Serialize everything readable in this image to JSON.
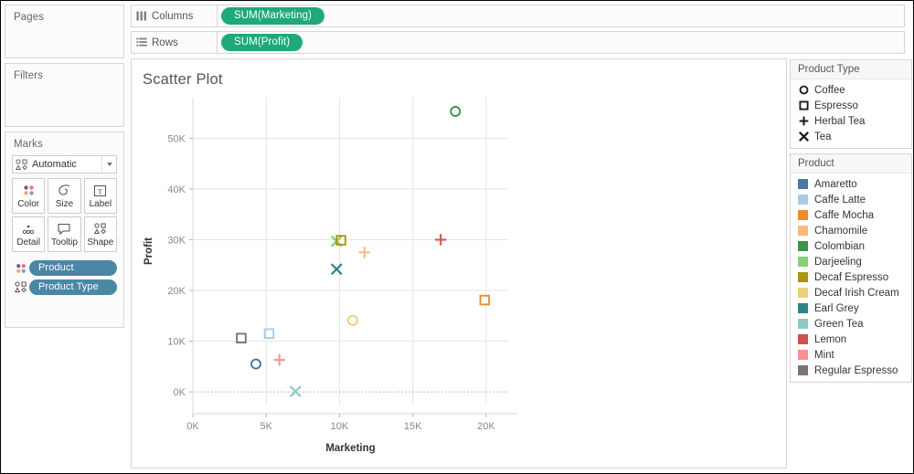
{
  "left_panel": {
    "pages": {
      "title": "Pages"
    },
    "filters": {
      "title": "Filters"
    },
    "marks": {
      "title": "Marks",
      "type_selector": {
        "label": "Automatic",
        "icon": "shapes-icon",
        "dropdown_icon": "chevron-down-icon"
      },
      "buttons": [
        {
          "label": "Color",
          "icon": "color-dots-icon"
        },
        {
          "label": "Size",
          "icon": "size-teardrop-icon"
        },
        {
          "label": "Label",
          "icon": "label-text-icon"
        },
        {
          "label": "Detail",
          "icon": "detail-dots-icon"
        },
        {
          "label": "Tooltip",
          "icon": "tooltip-bubble-icon"
        },
        {
          "label": "Shape",
          "icon": "shapes-icon"
        }
      ],
      "pills": [
        {
          "label": "Product",
          "icon": "color-dots-icon"
        },
        {
          "label": "Product Type",
          "icon": "shapes-icon"
        }
      ]
    }
  },
  "shelves": {
    "columns": {
      "label": "Columns",
      "icon": "columns-icon",
      "pill": "SUM(Marketing)"
    },
    "rows": {
      "label": "Rows",
      "icon": "rows-icon",
      "pill": "SUM(Profit)"
    }
  },
  "legends": {
    "product_type": {
      "title": "Product Type",
      "items": [
        {
          "label": "Coffee",
          "shape": "circle"
        },
        {
          "label": "Espresso",
          "shape": "square"
        },
        {
          "label": "Herbal Tea",
          "shape": "plus"
        },
        {
          "label": "Tea",
          "shape": "cross"
        }
      ]
    },
    "product": {
      "title": "Product",
      "items": [
        {
          "label": "Amaretto",
          "color": "#4878a8"
        },
        {
          "label": "Caffe Latte",
          "color": "#a8cce4"
        },
        {
          "label": "Caffe Mocha",
          "color": "#ee8c2a"
        },
        {
          "label": "Chamomile",
          "color": "#fbb77c"
        },
        {
          "label": "Colombian",
          "color": "#3f9448"
        },
        {
          "label": "Darjeeling",
          "color": "#84d176"
        },
        {
          "label": "Decaf Espresso",
          "color": "#a8960f"
        },
        {
          "label": "Decaf Irish Cream",
          "color": "#ecd074"
        },
        {
          "label": "Earl Grey",
          "color": "#2c8489"
        },
        {
          "label": "Green Tea",
          "color": "#8fcbc5"
        },
        {
          "label": "Lemon",
          "color": "#d0504c"
        },
        {
          "label": "Mint",
          "color": "#f79190"
        },
        {
          "label": "Regular Espresso",
          "color": "#7d7370"
        }
      ]
    }
  },
  "chart_data": {
    "type": "scatter",
    "title": "Scatter Plot",
    "xlabel": "Marketing",
    "ylabel": "Profit",
    "xlim": [
      0,
      21500
    ],
    "ylim": [
      -2500,
      58000
    ],
    "xticks": [
      0,
      5000,
      10000,
      15000,
      20000
    ],
    "xticklabels": [
      "0K",
      "5K",
      "10K",
      "15K",
      "20K"
    ],
    "yticks": [
      0,
      10000,
      20000,
      30000,
      40000,
      50000
    ],
    "yticklabels": [
      "0K",
      "10K",
      "20K",
      "30K",
      "40K",
      "50K"
    ],
    "grid": true,
    "points": [
      {
        "label": "Colombian",
        "product_type": "Coffee",
        "shape": "circle",
        "color": "#3f9448",
        "x": 17900,
        "y": 55300
      },
      {
        "label": "Darjeeling",
        "product_type": "Tea",
        "shape": "cross",
        "color": "#84d176",
        "x": 9800,
        "y": 29700
      },
      {
        "label": "Decaf Espresso",
        "product_type": "Espresso",
        "shape": "square",
        "color": "#a8960f",
        "x": 10100,
        "y": 29900
      },
      {
        "label": "Chamomile",
        "product_type": "Herbal Tea",
        "shape": "plus",
        "color": "#fbb77c",
        "x": 11700,
        "y": 27500
      },
      {
        "label": "Lemon",
        "product_type": "Herbal Tea",
        "shape": "plus",
        "color": "#d0504c",
        "x": 16900,
        "y": 30000
      },
      {
        "label": "Earl Grey",
        "product_type": "Tea",
        "shape": "cross",
        "color": "#2c8489",
        "x": 9800,
        "y": 24200
      },
      {
        "label": "Caffe Mocha",
        "product_type": "Espresso",
        "shape": "square",
        "color": "#ee8c2a",
        "x": 19900,
        "y": 18100
      },
      {
        "label": "Decaf Irish Cream",
        "product_type": "Coffee",
        "shape": "circle",
        "color": "#ecd074",
        "x": 10900,
        "y": 14100
      },
      {
        "label": "Caffe Latte",
        "product_type": "Espresso",
        "shape": "square",
        "color": "#a8cce4",
        "x": 5200,
        "y": 11500
      },
      {
        "label": "Regular Espresso",
        "product_type": "Espresso",
        "shape": "square",
        "color": "#7d7370",
        "x": 3300,
        "y": 10600
      },
      {
        "label": "Mint",
        "product_type": "Herbal Tea",
        "shape": "plus",
        "color": "#f79190",
        "x": 5900,
        "y": 6300
      },
      {
        "label": "Amaretto",
        "product_type": "Coffee",
        "shape": "circle",
        "color": "#4878a8",
        "x": 4300,
        "y": 5500
      },
      {
        "label": "Green Tea",
        "product_type": "Tea",
        "shape": "cross",
        "color": "#8fcbc5",
        "x": 7000,
        "y": 100
      }
    ]
  }
}
